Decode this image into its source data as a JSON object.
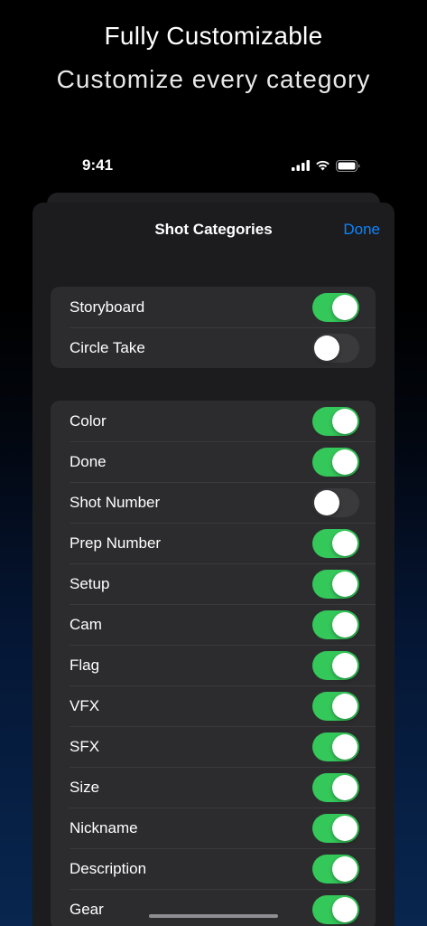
{
  "promo": {
    "headline": "Fully Customizable",
    "subheadline": "Customize every category"
  },
  "status_bar": {
    "time": "9:41",
    "icons": [
      "signal-icon",
      "wifi-icon",
      "battery-icon"
    ]
  },
  "nav": {
    "title": "Shot Categories",
    "done_label": "Done"
  },
  "colors": {
    "toggle_on": "#34c759",
    "toggle_off": "#3a3a3c",
    "accent": "#0a84ff",
    "sheet_bg": "#1c1c1e",
    "cell_bg": "#2c2c2e"
  },
  "groups": [
    {
      "items": [
        {
          "label": "Storyboard",
          "on": true
        },
        {
          "label": "Circle Take",
          "on": false
        }
      ]
    },
    {
      "items": [
        {
          "label": "Color",
          "on": true
        },
        {
          "label": "Done",
          "on": true
        },
        {
          "label": "Shot Number",
          "on": false
        },
        {
          "label": "Prep Number",
          "on": true
        },
        {
          "label": "Setup",
          "on": true
        },
        {
          "label": "Cam",
          "on": true
        },
        {
          "label": "Flag",
          "on": true
        },
        {
          "label": "VFX",
          "on": true
        },
        {
          "label": "SFX",
          "on": true
        },
        {
          "label": "Size",
          "on": true
        },
        {
          "label": "Nickname",
          "on": true
        },
        {
          "label": "Description",
          "on": true
        },
        {
          "label": "Gear",
          "on": true
        }
      ]
    }
  ]
}
